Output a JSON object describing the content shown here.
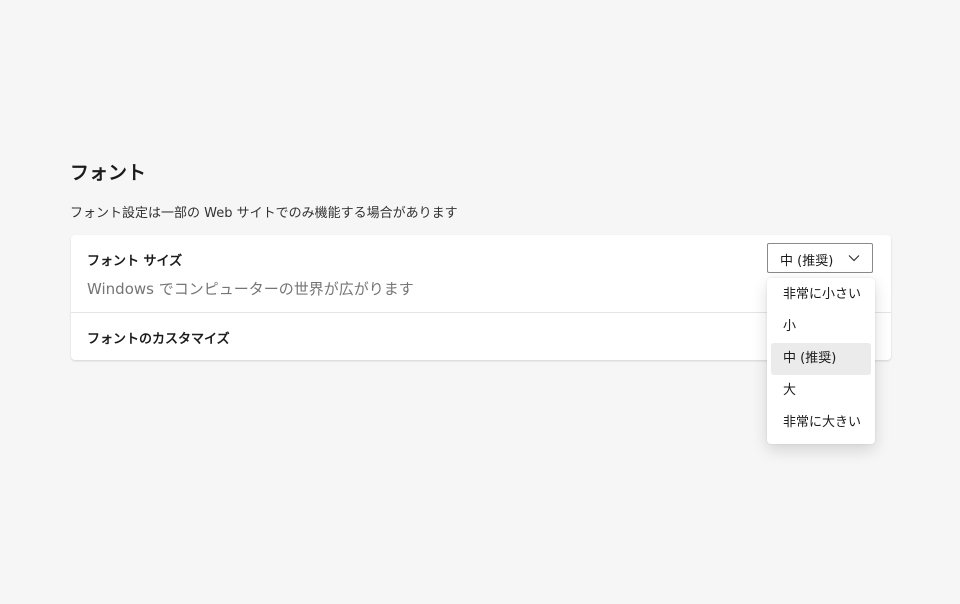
{
  "section": {
    "title": "フォント",
    "description": "フォント設定は一部の Web サイトでのみ機能する場合があります"
  },
  "font_size": {
    "title": "フォント サイズ",
    "subtitle": "Windows でコンピューターの世界が広がります",
    "selected": "中 (推奨)",
    "options": [
      "非常に小さい",
      "小",
      "中 (推奨)",
      "大",
      "非常に大きい"
    ],
    "selected_index": 2
  },
  "customize": {
    "title": "フォントのカスタマイズ"
  },
  "icons": {
    "dropdown_chevron": "chevron-down-icon"
  },
  "colors": {
    "background": "#f6f6f6",
    "card": "#ffffff",
    "selected_option": "#ebebeb",
    "secondary_text": "#757575"
  }
}
